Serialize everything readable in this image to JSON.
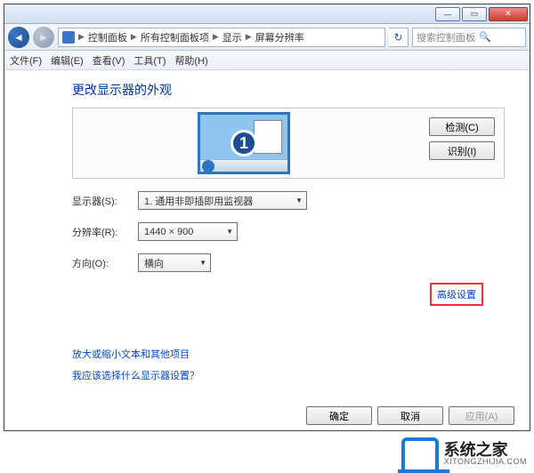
{
  "titlebar": {
    "min": "—",
    "max": "▭",
    "close": "✕"
  },
  "nav": {
    "crumbs": [
      "控制面板",
      "所有控制面板项",
      "显示",
      "屏幕分辨率"
    ],
    "search_placeholder": "搜索控制面板"
  },
  "menu": {
    "file": "文件(F)",
    "edit": "编辑(E)",
    "view": "查看(V)",
    "tools": "工具(T)",
    "help": "帮助(H)"
  },
  "heading": "更改显示器的外观",
  "preview": {
    "detect": "检测(C)",
    "identify": "识别(I)",
    "monitor_num": "1"
  },
  "fields": {
    "display_label": "显示器(S):",
    "display_value": "1. 通用非即插即用监视器",
    "resolution_label": "分辨率(R):",
    "resolution_value": "1440 × 900",
    "orientation_label": "方向(O):",
    "orientation_value": "横向"
  },
  "links": {
    "advanced": "高级设置",
    "zoom_text": "放大或缩小文本和其他项目",
    "which_settings": "我应该选择什么显示器设置？"
  },
  "footer": {
    "ok": "确定",
    "cancel": "取消",
    "apply": "应用(A)"
  },
  "watermark": {
    "cn": "系统之家",
    "en": "XITONGZHIJIA.COM"
  }
}
